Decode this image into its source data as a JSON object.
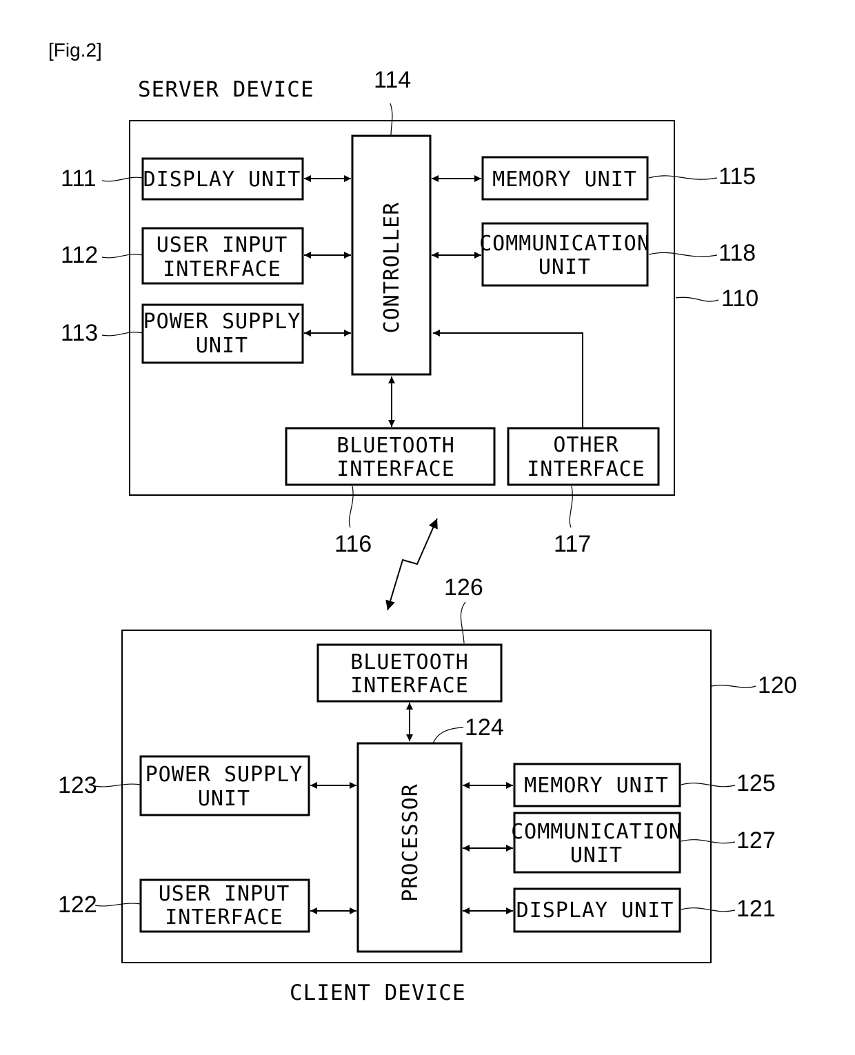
{
  "figure": {
    "label": "[Fig.2]"
  },
  "server": {
    "title": "SERVER DEVICE",
    "ref": "110",
    "controller": {
      "label": "CONTROLLER",
      "ref": "114"
    },
    "blocks": {
      "display": {
        "lines": [
          "DISPLAY UNIT"
        ],
        "ref": "111"
      },
      "user_input": {
        "lines": [
          "USER INPUT",
          "INTERFACE"
        ],
        "ref": "112"
      },
      "power": {
        "lines": [
          "POWER SUPPLY",
          "UNIT"
        ],
        "ref": "113"
      },
      "memory": {
        "lines": [
          "MEMORY UNIT"
        ],
        "ref": "115"
      },
      "communication": {
        "lines": [
          "COMMUNICATION",
          "UNIT"
        ],
        "ref": "118"
      },
      "bluetooth": {
        "lines": [
          "BLUETOOTH",
          "INTERFACE"
        ],
        "ref": "116"
      },
      "other": {
        "lines": [
          "OTHER",
          "INTERFACE"
        ],
        "ref": "117"
      }
    }
  },
  "client": {
    "title": "CLIENT DEVICE",
    "ref": "120",
    "processor": {
      "label": "PROCESSOR",
      "ref": "124"
    },
    "blocks": {
      "bluetooth": {
        "lines": [
          "BLUETOOTH",
          "INTERFACE"
        ],
        "ref": "126"
      },
      "power": {
        "lines": [
          "POWER SUPPLY",
          "UNIT"
        ],
        "ref": "123"
      },
      "user_input": {
        "lines": [
          "USER INPUT",
          "INTERFACE"
        ],
        "ref": "122"
      },
      "memory": {
        "lines": [
          "MEMORY UNIT"
        ],
        "ref": "125"
      },
      "communication": {
        "lines": [
          "COMMUNICATION",
          "UNIT"
        ],
        "ref": "127"
      },
      "display": {
        "lines": [
          "DISPLAY UNIT"
        ],
        "ref": "121"
      }
    }
  },
  "wireless_link": {
    "icon": "wireless-link-icon"
  }
}
